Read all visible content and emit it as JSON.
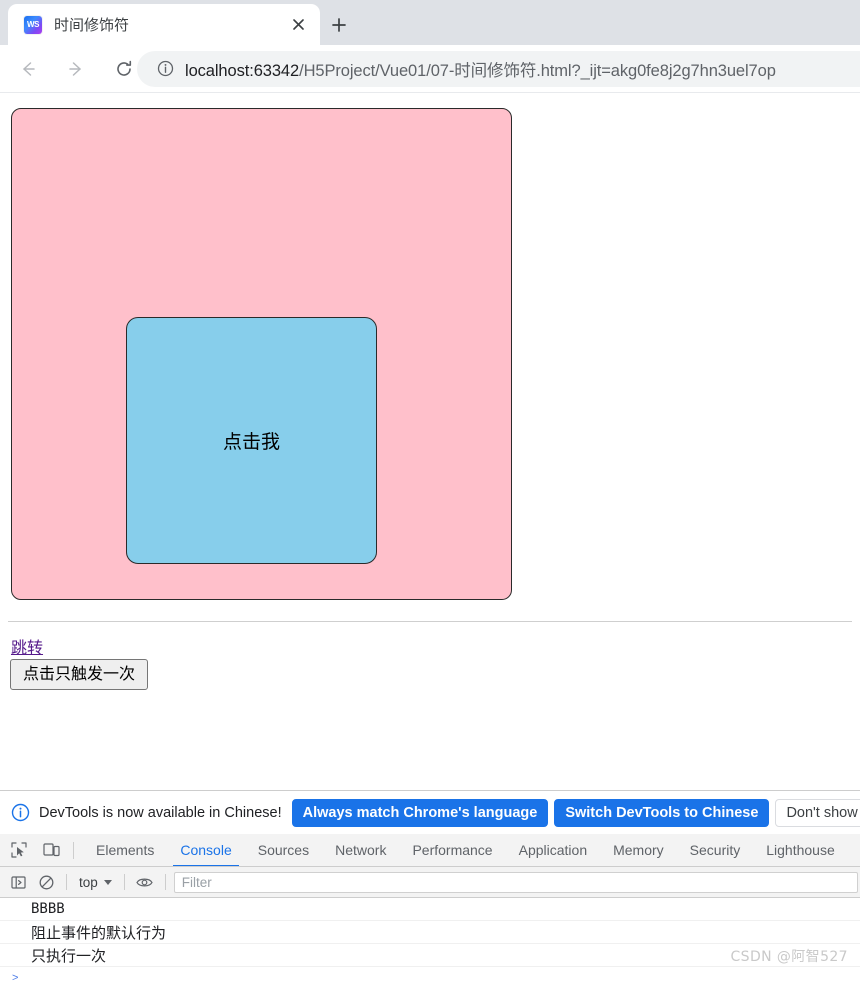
{
  "browser": {
    "tab": {
      "title": "时间修饰符",
      "favicon": "webstorm-icon",
      "close_icon": "close-icon"
    },
    "new_tab_icon": "plus-icon",
    "nav": {
      "back_icon": "back-arrow-icon",
      "forward_icon": "forward-arrow-icon",
      "reload_icon": "reload-icon"
    },
    "omnibox": {
      "info_icon": "info-circle-icon",
      "host": "localhost:63342",
      "path": "/H5Project/Vue01/07-时间修饰符.html?_ijt=akg0fe8j2g7hn3uel7op"
    }
  },
  "page": {
    "outer_box": {
      "color": "#ffc0cb"
    },
    "inner_box": {
      "color": "#87ceeb",
      "label": "点击我"
    },
    "jump_link": "跳转",
    "once_button": "点击只触发一次"
  },
  "devtools": {
    "notice": {
      "icon": "info-circle-icon",
      "text": "DevTools is now available in Chinese!",
      "buttons": [
        {
          "label": "Always match Chrome's language",
          "style": "primary"
        },
        {
          "label": "Switch DevTools to Chinese",
          "style": "primary"
        },
        {
          "label": "Don't show again",
          "style": "secondary"
        }
      ]
    },
    "toolbar_icons": {
      "inspect": "inspect-element-icon",
      "device": "device-toolbar-icon"
    },
    "tabs": [
      {
        "label": "Elements",
        "active": false
      },
      {
        "label": "Console",
        "active": true
      },
      {
        "label": "Sources",
        "active": false
      },
      {
        "label": "Network",
        "active": false
      },
      {
        "label": "Performance",
        "active": false
      },
      {
        "label": "Application",
        "active": false
      },
      {
        "label": "Memory",
        "active": false
      },
      {
        "label": "Security",
        "active": false
      },
      {
        "label": "Lighthouse",
        "active": false
      }
    ],
    "console_toolbar": {
      "sidebar_icon": "console-sidebar-icon",
      "clear_icon": "clear-console-icon",
      "context": "top",
      "eye_icon": "live-expression-icon",
      "filter_placeholder": "Filter"
    },
    "console_messages": [
      {
        "text": "BBBB",
        "cjk": false
      },
      {
        "text": "阻止事件的默认行为",
        "cjk": true
      },
      {
        "text": "只执行一次",
        "cjk": true
      }
    ],
    "prompt_arrow": ">"
  },
  "watermark": "CSDN @阿智527",
  "colors": {
    "accent": "#1a73e8",
    "tabstrip": "#dee1e6",
    "pink": "#ffc0cb",
    "skyblue": "#87ceeb",
    "link": "#551a8b"
  }
}
